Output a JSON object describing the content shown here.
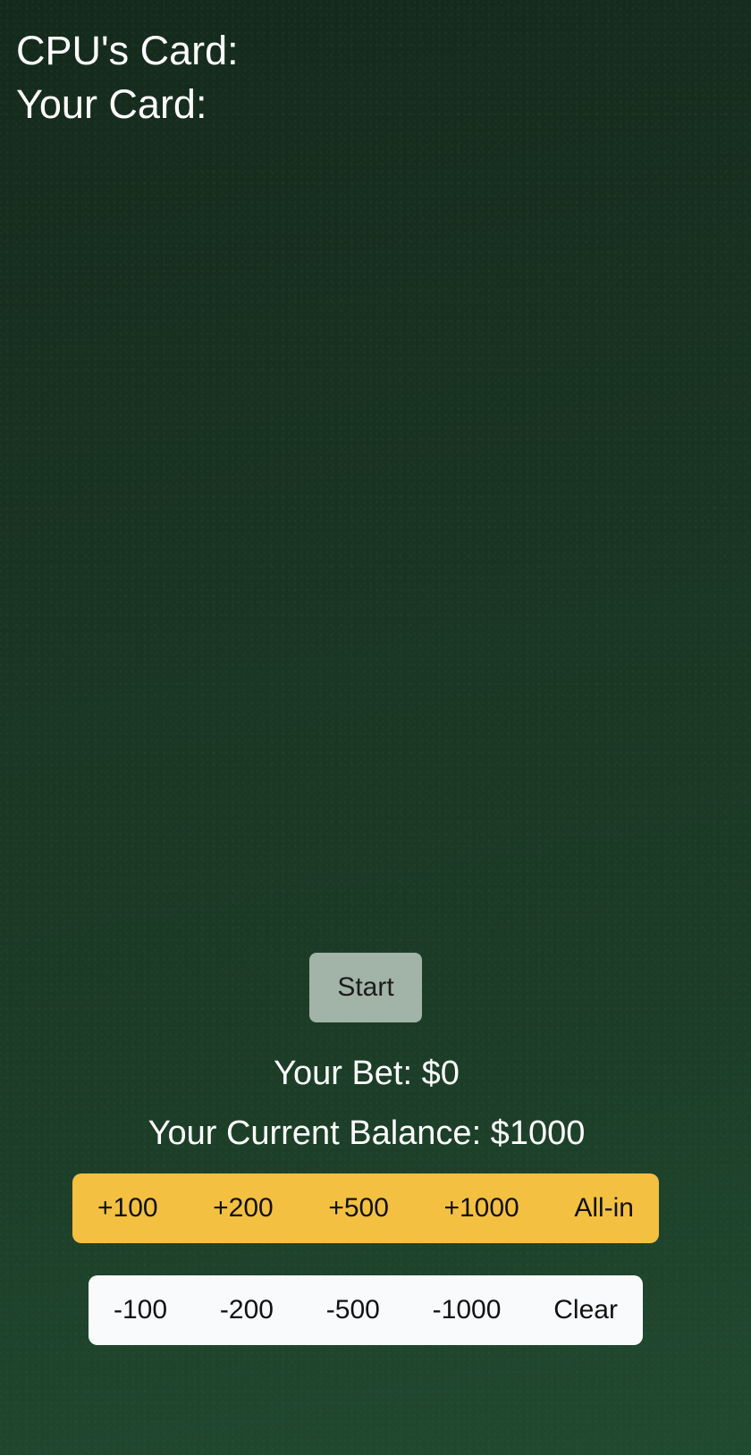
{
  "cards": {
    "cpu_label": "CPU's Card:",
    "player_label": "Your Card:"
  },
  "controls": {
    "start_label": "Start"
  },
  "status": {
    "bet_text": "Your Bet: $0",
    "balance_text": "Your Current Balance: $1000"
  },
  "add_buttons": {
    "plus_100": "+100",
    "plus_200": "+200",
    "plus_500": "+500",
    "plus_1000": "+1000",
    "all_in": "All-in"
  },
  "sub_buttons": {
    "minus_100": "-100",
    "minus_200": "-200",
    "minus_500": "-500",
    "minus_1000": "-1000",
    "clear": "Clear"
  },
  "colors": {
    "table_green": "#1c3c27",
    "add_row": "#f3c042",
    "sub_row": "#f9fafb",
    "start_button": "#a2b3a7"
  }
}
